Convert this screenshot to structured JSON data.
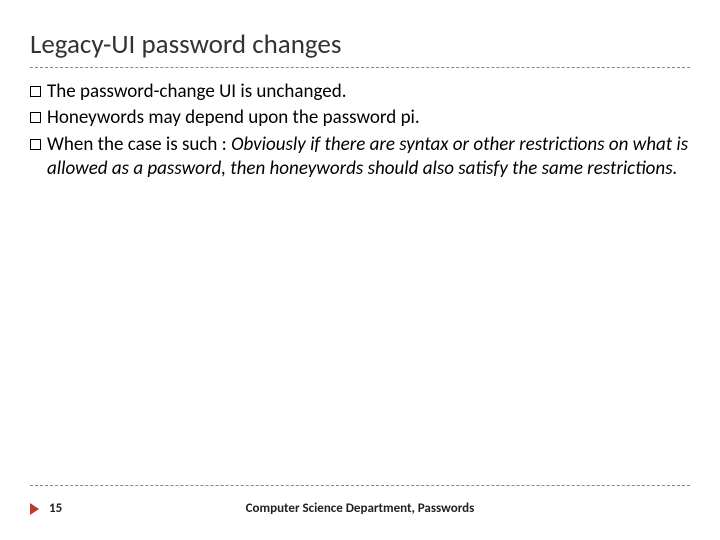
{
  "title": "Legacy-UI password changes",
  "bullets": [
    {
      "text": "The password-change UI is unchanged."
    },
    {
      "text": "Honeywords may depend upon the password pi."
    },
    {
      "lead": "When the case is such : ",
      "ital": "Obviously if there are syntax or other restrictions on what is allowed as a password, then honeywords should also satisfy the same restrictions."
    }
  ],
  "footer": {
    "page": "15",
    "center": "Computer Science Department, Passwords"
  }
}
